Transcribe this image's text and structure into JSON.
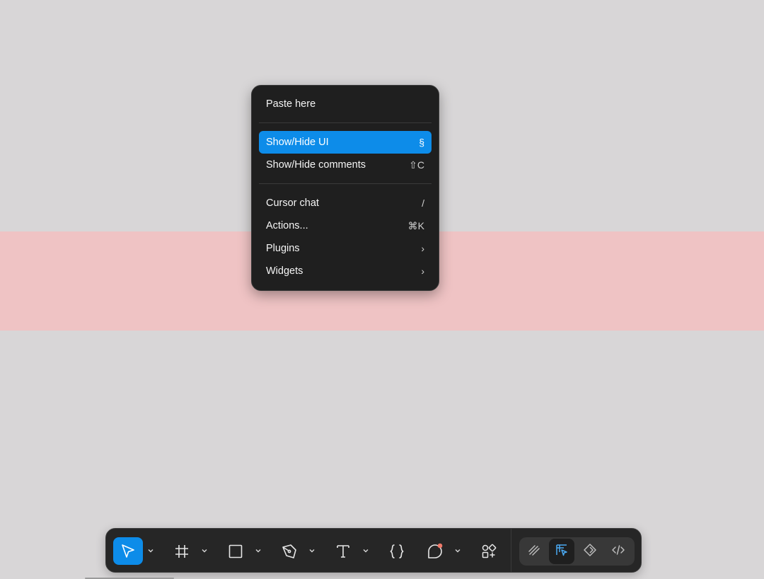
{
  "context_menu": {
    "items": [
      {
        "label": "Paste here",
        "shortcut": ""
      },
      {
        "label": "Show/Hide UI",
        "shortcut": "§"
      },
      {
        "label": "Show/Hide comments",
        "shortcut": "⇧C"
      },
      {
        "label": "Cursor chat",
        "shortcut": "/"
      },
      {
        "label": "Actions...",
        "shortcut": "⌘K"
      },
      {
        "label": "Plugins",
        "shortcut": "›"
      },
      {
        "label": "Widgets",
        "shortcut": "›"
      }
    ],
    "highlighted_item": "Show/Hide UI"
  },
  "toolbar": {
    "tools": [
      {
        "name": "move-tool",
        "icon": "cursor-arrow-icon",
        "active": true
      },
      {
        "name": "frame-tool",
        "icon": "frame-hash-icon",
        "active": false
      },
      {
        "name": "shape-tool",
        "icon": "rectangle-icon",
        "active": false
      },
      {
        "name": "pen-tool",
        "icon": "pen-icon",
        "active": false
      },
      {
        "name": "text-tool",
        "icon": "text-t-icon",
        "active": false
      },
      {
        "name": "code-tool",
        "icon": "curly-braces-icon",
        "active": false
      },
      {
        "name": "comment-tool",
        "icon": "comment-bubble-icon",
        "active": false,
        "notification_dot": true
      },
      {
        "name": "resources-tool",
        "icon": "components-grid-icon",
        "active": false
      }
    ],
    "modes": [
      {
        "name": "draw-mode",
        "icon": "draw-squiggle-icon",
        "active": false
      },
      {
        "name": "design-mode",
        "icon": "design-select-icon",
        "active": true
      },
      {
        "name": "dev-mode-component",
        "icon": "component-diamond-icon",
        "active": false
      },
      {
        "name": "dev-mode",
        "icon": "code-brackets-icon",
        "active": false
      }
    ]
  },
  "colors": {
    "canvas": "#d8d6d7",
    "band": "#efc3c4",
    "menu_bg": "#1f1f1f",
    "accent": "#0d8ce9",
    "notification": "#f07a6a"
  }
}
